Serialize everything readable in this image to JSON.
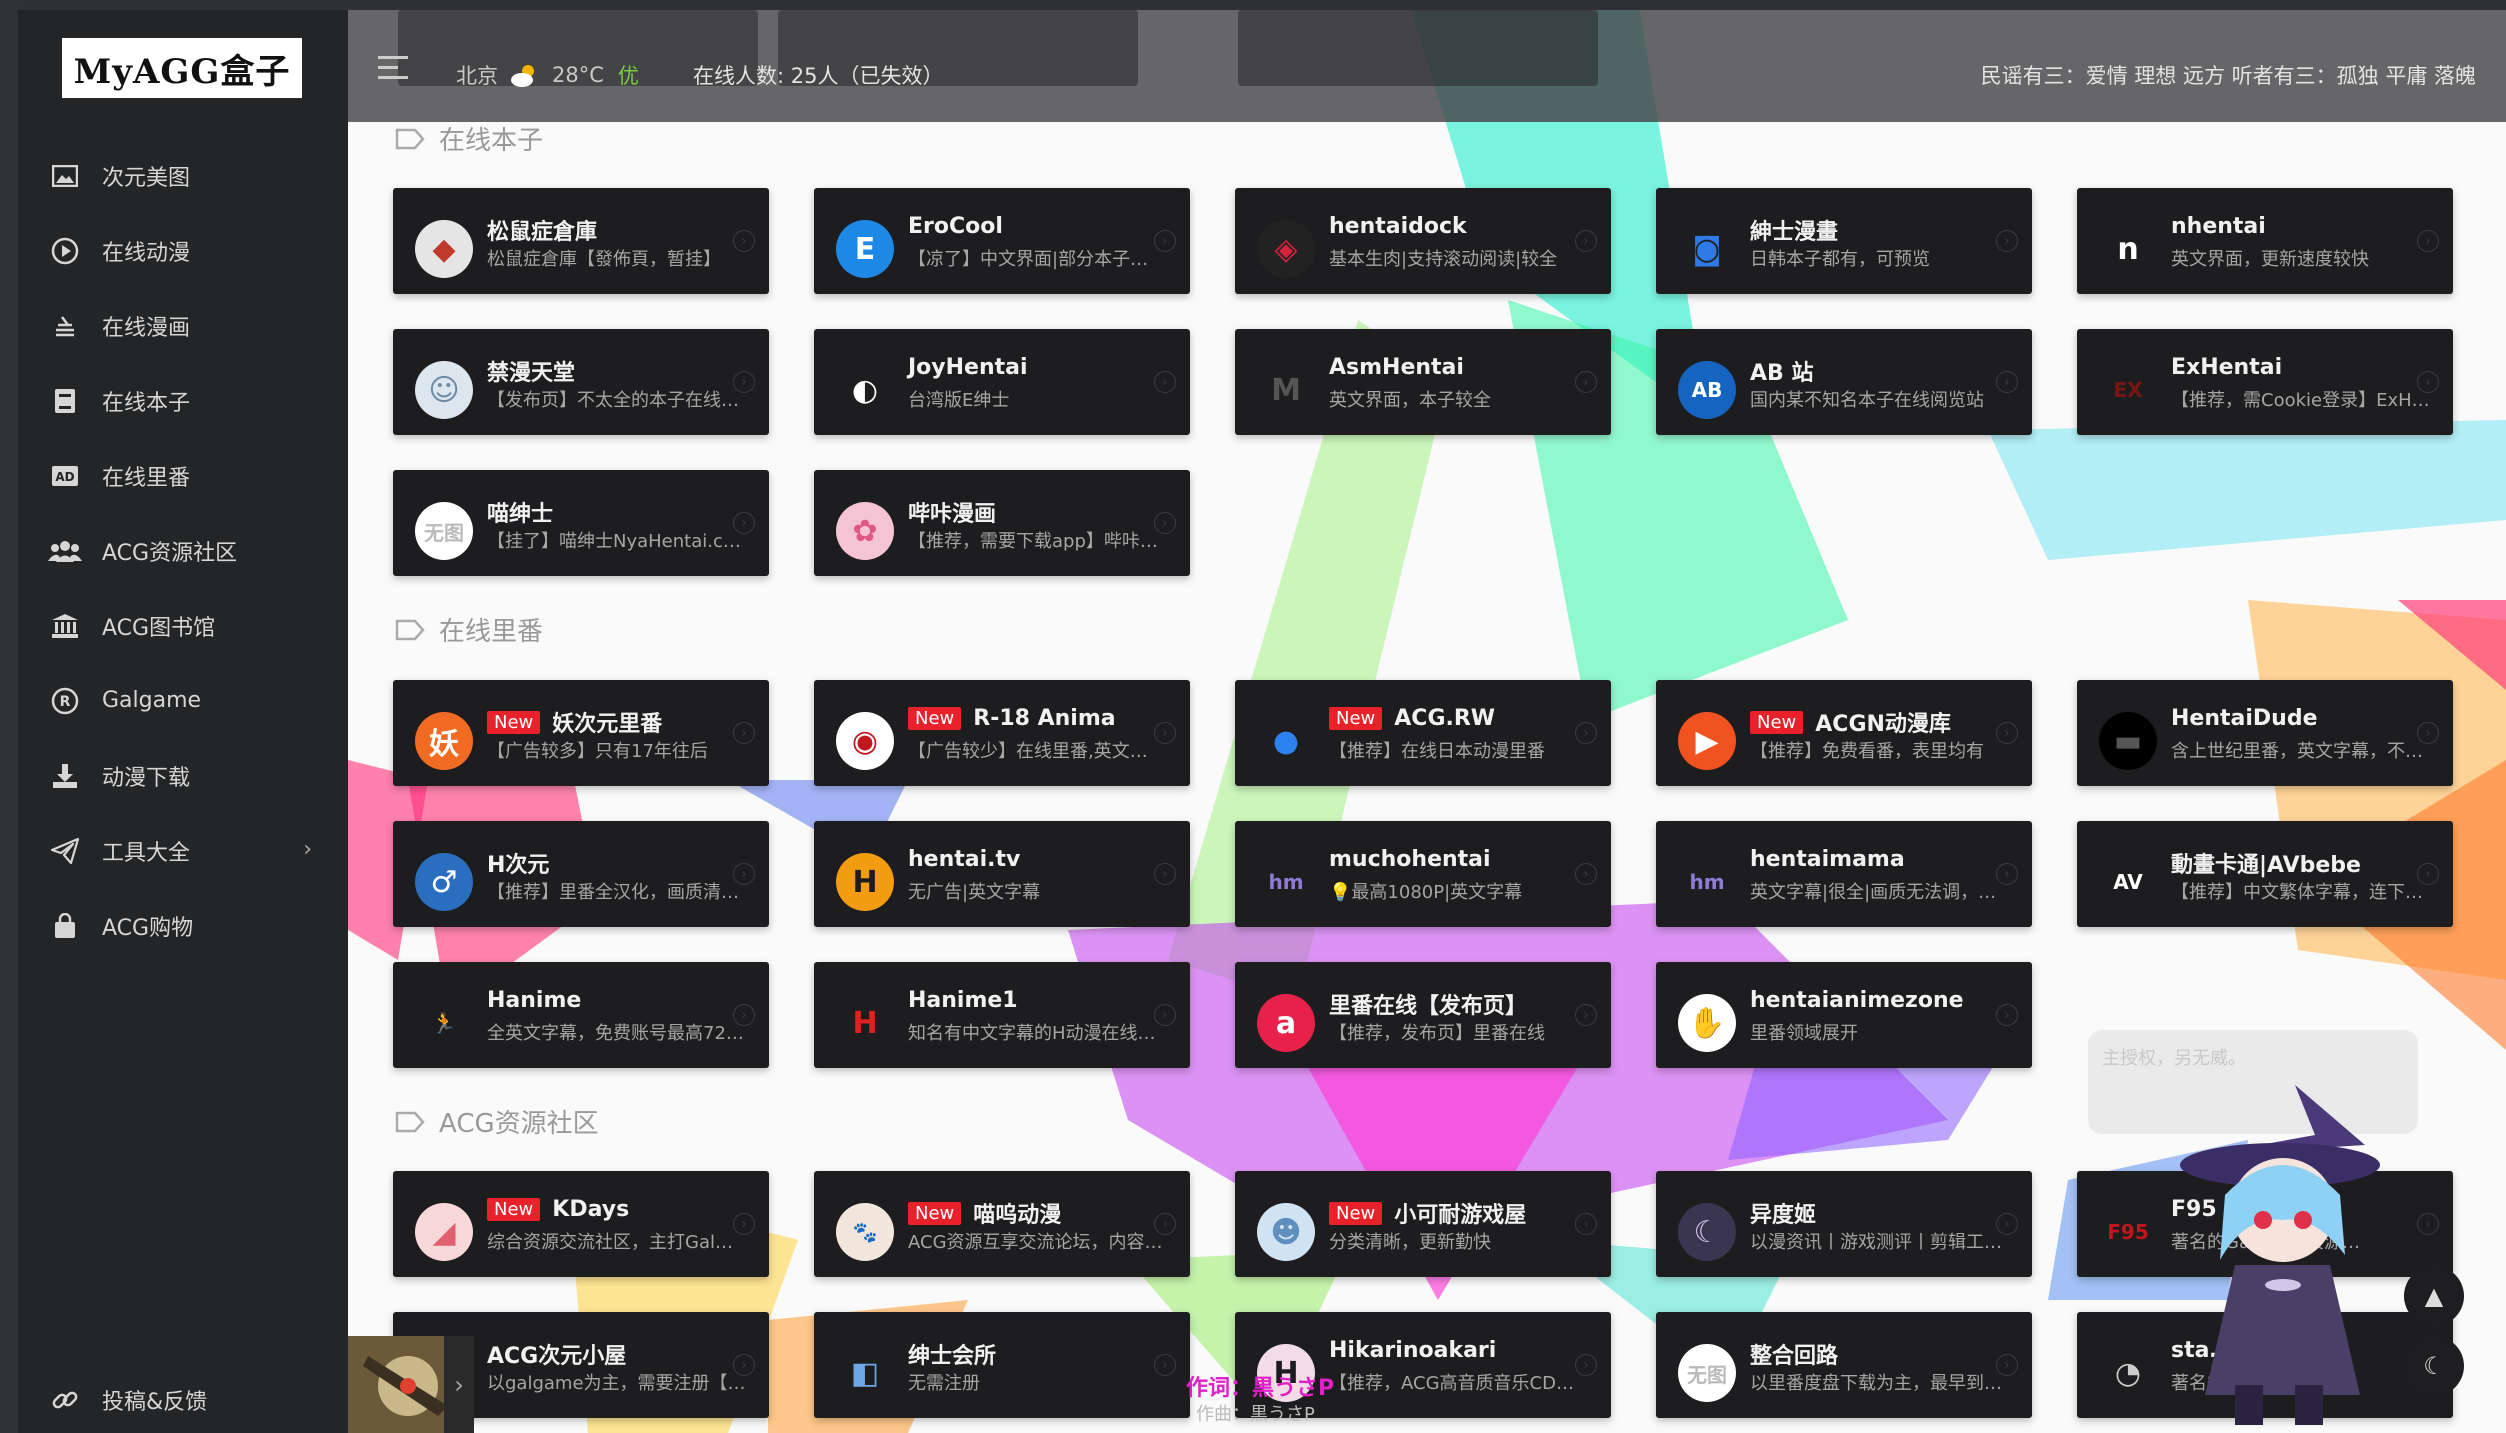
{
  "app": {
    "logo": "MyAGG盒子"
  },
  "header": {
    "city": "北京",
    "temp": "28°C",
    "aqi": "优",
    "online": "在线人数: 25人（已失效）",
    "motto": "民谣有三：爱情 理想 远方 听者有三：孤独 平庸 落魄"
  },
  "sidebar": {
    "items": [
      {
        "label": "次元美图",
        "icon": "image-icon"
      },
      {
        "label": "在线动漫",
        "icon": "play-icon"
      },
      {
        "label": "在线漫画",
        "icon": "book-stack-icon"
      },
      {
        "label": "在线本子",
        "icon": "book-icon"
      },
      {
        "label": "在线里番",
        "icon": "ad-icon"
      },
      {
        "label": "ACG资源社区",
        "icon": "users-icon"
      },
      {
        "label": "ACG图书馆",
        "icon": "library-icon"
      },
      {
        "label": "Galgame",
        "icon": "registered-icon"
      },
      {
        "label": "动漫下载",
        "icon": "download-icon"
      },
      {
        "label": "工具大全",
        "icon": "send-icon"
      },
      {
        "label": "ACG购物",
        "icon": "bag-icon"
      }
    ],
    "bottom": "投稿&反馈"
  },
  "sections": [
    {
      "title": "在线本子",
      "cards": [
        {
          "title": "松鼠症倉庫",
          "desc": "松鼠症倉庫【發佈頁，暂挂】",
          "icon_bg": "#e5e5e5",
          "icon_text": "◆",
          "icon_color": "#c0392b"
        },
        {
          "title": "EroCool",
          "desc": "【凉了】中文界面|部分本子…",
          "icon_bg": "#1e88e5",
          "icon_text": "E",
          "icon_color": "#ffffff"
        },
        {
          "title": "hentaidock",
          "desc": "基本生肉|支持滚动阅读|较全",
          "icon_bg": "#222222",
          "icon_text": "◈",
          "icon_color": "#d6213a"
        },
        {
          "title": "紳士漫畫",
          "desc": "日韩本子都有，可预览",
          "icon_bg": "#1d1d1f",
          "icon_text": "◙",
          "icon_color": "#2f7be6"
        },
        {
          "title": "nhentai",
          "desc": "英文界面，更新速度较快",
          "icon_bg": "#1d1d1f",
          "icon_text": "n",
          "icon_color": "#ffffff"
        },
        {
          "title": "禁漫天堂",
          "desc": "【发布页】不太全的本子在线…",
          "icon_bg": "#dde6ee",
          "icon_text": "☺",
          "icon_color": "#6c8aa6"
        },
        {
          "title": "JoyHentai",
          "desc": "台湾版E绅士",
          "icon_bg": "#1d1d1f",
          "icon_text": "◐",
          "icon_color": "#ffffff"
        },
        {
          "title": "AsmHentai",
          "desc": "英文界面，本子较全",
          "icon_bg": "#1d1d1f",
          "icon_text": "M",
          "icon_color": "#555555"
        },
        {
          "title": "AB 站",
          "desc": "国内某不知名本子在线阅览站",
          "icon_bg": "#1565c0",
          "icon_text": "AB",
          "icon_color": "#ffffff"
        },
        {
          "title": "ExHentai",
          "desc": "【推荐，需Cookie登录】ExH…",
          "icon_bg": "#1d1d1f",
          "icon_text": "EX",
          "icon_color": "#7a1515"
        },
        {
          "title": "喵绅士",
          "desc": "【挂了】喵绅士NyaHentai.c…",
          "icon_bg": "#ffffff",
          "icon_text": "无图",
          "icon_color": "#bbbbbb"
        },
        {
          "title": "哔咔漫画",
          "desc": "【推荐，需要下载app】哔咔…",
          "icon_bg": "#f5c4d4",
          "icon_text": "✿",
          "icon_color": "#e05684"
        }
      ]
    },
    {
      "title": "在线里番",
      "cards": [
        {
          "title": "妖次元里番",
          "new": "New",
          "desc": "【广告较多】只有17年往后",
          "icon_bg": "#f26b22",
          "icon_text": "妖",
          "icon_color": "#ffffff"
        },
        {
          "title": "R-18 Anima",
          "new": "New",
          "desc": "【广告较少】在线里番,英文…",
          "icon_bg": "#ffffff",
          "icon_text": "◉",
          "icon_color": "#c0161d"
        },
        {
          "title": "ACG.RW",
          "new": "New",
          "desc": "【推荐】在线日本动漫里番",
          "icon_bg": "#1d1d1f",
          "icon_text": "●",
          "icon_color": "#2b82f0"
        },
        {
          "title": "ACGN动漫库",
          "new": "New",
          "desc": "【推荐】免费看番，表里均有",
          "icon_bg": "#f0531f",
          "icon_text": "▶",
          "icon_color": "#ffffff"
        },
        {
          "title": "HentaiDude",
          "desc": "含上世纪里番，英文字幕，不…",
          "icon_bg": "#000000",
          "icon_text": "▬",
          "icon_color": "#555555"
        },
        {
          "title": "H次元",
          "desc": "【推荐】里番全汉化，画质清…",
          "icon_bg": "#2a6fbf",
          "icon_text": "♂",
          "icon_color": "#ffffff"
        },
        {
          "title": "hentai.tv",
          "desc": "无广告|英文字幕",
          "icon_bg": "#f39c12",
          "icon_text": "H",
          "icon_color": "#1d1d1f"
        },
        {
          "title": "muchohentai",
          "desc": "💡最高1080P|英文字幕",
          "icon_bg": "#1d1d1f",
          "icon_text": "hm",
          "icon_color": "#8e7bd6"
        },
        {
          "title": "hentaimama",
          "desc": "英文字幕|很全|画质无法调，…",
          "icon_bg": "#1d1d1f",
          "icon_text": "hm",
          "icon_color": "#8e7bd6"
        },
        {
          "title": "動畫卡通|AVbebe",
          "desc": "【推荐】中文繁体字幕，连下…",
          "icon_bg": "#1d1d1f",
          "icon_text": "AV",
          "icon_color": "#ffffff"
        },
        {
          "title": "Hanime",
          "desc": "全英文字幕，免费账号最高72…",
          "icon_bg": "#1d1d1f",
          "icon_text": "🏃",
          "icon_color": "#ffffff"
        },
        {
          "title": "Hanime1",
          "desc": "知名有中文字幕的H动漫在线…",
          "icon_bg": "#1d1d1f",
          "icon_text": "H",
          "icon_color": "#e02020"
        },
        {
          "title": "里番在线【发布页】",
          "desc": "【推荐，发布页】里番在线",
          "icon_bg": "#e8214b",
          "icon_text": "a",
          "icon_color": "#ffffff"
        },
        {
          "title": "hentaianimezone",
          "desc": "里番领域展开",
          "icon_bg": "#ffffff",
          "icon_text": "✋",
          "icon_color": "#333333"
        }
      ]
    },
    {
      "title": "ACG资源社区",
      "cards": [
        {
          "title": "KDays",
          "new": "New",
          "desc": "综合资源交流社区，主打Gal…",
          "icon_bg": "#f7d8d8",
          "icon_text": "◢",
          "icon_color": "#e06070"
        },
        {
          "title": "喵呜动漫",
          "new": "New",
          "desc": "ACG资源互享交流论坛，内容…",
          "icon_bg": "#f2e6dc",
          "icon_text": "🐾",
          "icon_color": "#c77c5a"
        },
        {
          "title": "小可耐游戏屋",
          "new": "New",
          "desc": "分类清晰，更新勤快",
          "icon_bg": "#cfe3f2",
          "icon_text": "☻",
          "icon_color": "#5f8fbf"
        },
        {
          "title": "异度姬",
          "desc": "以漫资讯丨游戏测评丨剪辑工…",
          "icon_bg": "#3a3550",
          "icon_text": "☾",
          "icon_color": "#d7c6f0"
        },
        {
          "title": "F95 ZONE",
          "desc": "著名的Galgame资源…",
          "icon_bg": "#1d1d1f",
          "icon_text": "F95",
          "icon_color": "#c0161d"
        },
        {
          "title": "ACG次元小屋",
          "desc": "以galgame为主，需要注册【…",
          "icon_bg": "#1d1d1f",
          "icon_text": "",
          "icon_color": "#ffffff"
        },
        {
          "title": "绅士会所",
          "desc": "无需注册",
          "icon_bg": "#1d1d1f",
          "icon_text": "◧",
          "icon_color": "#6fa6e8"
        },
        {
          "title": "Hikarinoakari",
          "desc": "【推荐，ACG高音质音乐CD下…",
          "icon_bg": "#f2dde6",
          "icon_text": "H",
          "icon_color": "#1d1d1f"
        },
        {
          "title": "整合回路",
          "desc": "以里番度盘下载为主，最早到…",
          "icon_bg": "#ffffff",
          "icon_text": "无图",
          "icon_color": "#bbbbbb"
        },
        {
          "title": "sta…",
          "desc": "著名的…论坛",
          "icon_bg": "#1d1d1f",
          "icon_text": "◔",
          "icon_color": "#cccccc"
        }
      ]
    }
  ],
  "widgets": {
    "comment_placeholder": "主授权，另无威。",
    "lyric_line": "作词：黒うさP",
    "lyric_sub": "作曲：黒うさP"
  }
}
